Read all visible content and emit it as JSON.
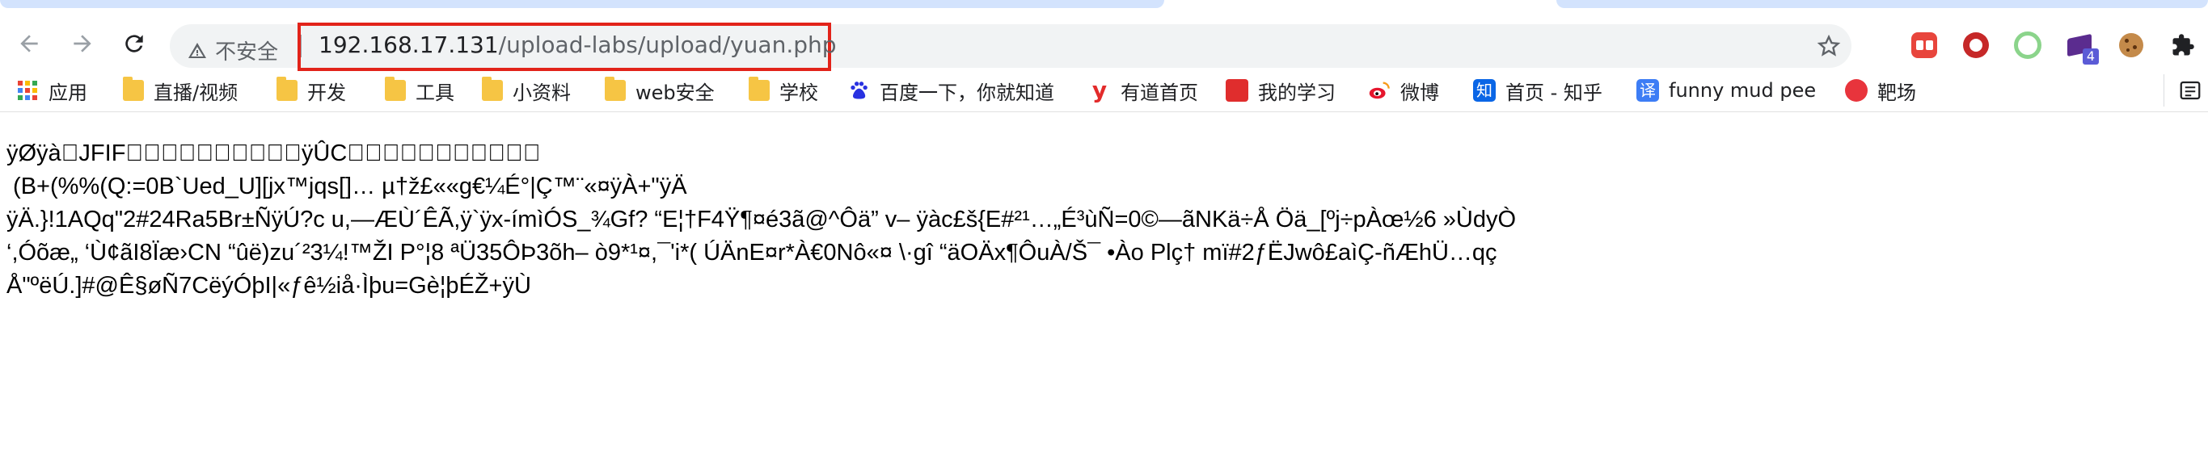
{
  "browser": {
    "security_label": "不安全",
    "url_host": "192.168.17.131",
    "url_path": "/upload-labs/upload/yuan.php"
  },
  "bookmarks": [
    {
      "label": "应用",
      "icon": "apps-grid-icon"
    },
    {
      "label": "直播/视频",
      "icon": "folder-icon"
    },
    {
      "label": "开发",
      "icon": "folder-icon"
    },
    {
      "label": "工具",
      "icon": "folder-icon"
    },
    {
      "label": "小资料",
      "icon": "folder-icon"
    },
    {
      "label": "web安全",
      "icon": "folder-icon"
    },
    {
      "label": "学校",
      "icon": "folder-icon"
    },
    {
      "label": "百度一下，你就知道",
      "icon": "baidu-paw-icon"
    },
    {
      "label": "有道首页",
      "icon": "youdao-icon"
    },
    {
      "label": "我的学习",
      "icon": "red-book-icon"
    },
    {
      "label": "微博",
      "icon": "weibo-icon"
    },
    {
      "label": "首页 - 知乎",
      "icon": "zhihu-icon"
    },
    {
      "label": "funny mud pee",
      "icon": "translate-icon"
    },
    {
      "label": "靶场",
      "icon": "bilibili-red-icon"
    }
  ],
  "extensions": {
    "badge_count": "4"
  },
  "page": {
    "text": "ÿØÿà\u0000JFIF\u0000\u0001\u0001\u0000\u0000\u0001\u0000\u0001\u0000\u0000ÿÛC\u0000\b\u0006\u0006\u0007\u0006\u0005\b\u0007\u0007\u0007\t\t\b\n\f\u0014\r\f\u000b\u000b\f\u0019\u0012\u0013\u000f (B+(%%(Q:=0B`Ued_U][jx™jqs[]… µ†ž£««g€¼É°|Ç™¨«¤ÿÀ\u0000\u0011\b\u0001+\u0001\u0000\u0003\u0001\"\u0000\u0002\u0011\u0001\u0003\u0011\u0001ÿÄ\u0000\u001f\u0000\u0000\u0001\u0005\u0001\u0001\u0001\u0001\u0001\u0001\u0000\u0000\u0000\u0000\u0000\u0000\u0000\u0000\u0001\u0002\u0003\u0004\u0005\u0006\u0007\b\t\n\u000bÿÄ.\u0010\u0000\u0002\u0001\u0003\u0003\u0002\u0004\u0003\u0005\u0005\u0004\u0004\u0000\u0000\u0001}\u0001\u0002\u0003\u0000\u0004\u0011\u0005\u0012!1AQq\u0013\"2\u0014#24Ra5Br±ÑÿÚ\f\u0003\u0001\u0000\u0002?c u,—ÆÙ´ÊÃ,ÿ`ÿx-ímìÓS_¾G\u0006f? “E¦†F4Ÿ¶¤é\u0011\u00063ã@^Ôä” v– ÿ\u0013àc£š{E\u0014#²¹…„É³ùÑ=\u0000\u00000\u0000©—ãNKä÷\u0014Å Öä_[ºj÷pÀœ½6 »ÙdyÒ ‘,Óõæ„ ‘Ù¢ãI8Ïæ›C\u0004\u0005\u0006N “\u0000ûë)zu´²3¼!™ŽI P°¦8 ªÜ3\u00195ÔÞ3õ\u0000\u0000h– ò9*¹\u0000¤,¯'i*( ÚÄnE\u0000¤r*À€0Nô«¤ \\·gî “äO\u0000Äx\u0010¶ÔuÀ/\u0016Š¯ •Ào Plç† mï#2ƒËJwô£a\u0014ìÇ-\u0011ñÆhÜ…qçÅ\"ºëÚ.]#@Ê§øÑ7\u0011CëýÓ\u0007þI|«ƒê½iå·Ìþu=Gè¦þ\u0007ÉŽ+ÿÙ"
  }
}
